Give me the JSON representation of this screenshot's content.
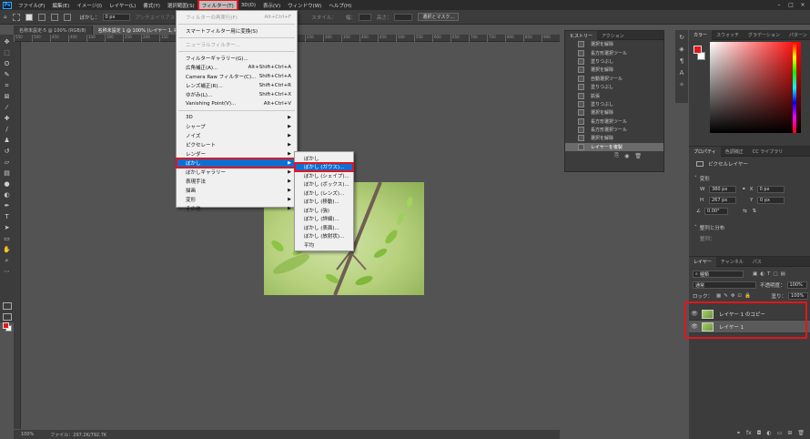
{
  "menubar": {
    "items": [
      "ファイル(F)",
      "編集(E)",
      "イメージ(I)",
      "レイヤー(L)",
      "書式(Y)",
      "選択範囲(S)",
      "フィルター(T)",
      "3D(D)",
      "表示(V)",
      "ウィンドウ(W)",
      "ヘルプ(H)"
    ],
    "active_index": 6,
    "logo": "Ps"
  },
  "options_bar": {
    "feather_label": "ぼかし：",
    "feather_value": "0 px",
    "antialias_label": "アンチエイリアス",
    "style_label": "スタイル：",
    "width_label": "幅：",
    "height_label": "高さ：",
    "select_mask_button": "選択とマスク..."
  },
  "doc_tabs": [
    "名称未設定-5 @ 100% (RGB/8)",
    "名称未設定 1 @ 100% (レイヤー 1, RGB/8)"
  ],
  "ruler_labels": [
    "550",
    "500",
    "450",
    "400",
    "350",
    "300",
    "250",
    "200",
    "150",
    "100",
    "50",
    "0",
    "50",
    "100",
    "150",
    "200",
    "250",
    "300",
    "350",
    "400",
    "450",
    "500",
    "550",
    "600",
    "650",
    "700",
    "750",
    "800",
    "850",
    "900"
  ],
  "status": {
    "zoom": "100%",
    "file_info": "ファイル：297.2K/792.7K"
  },
  "filter_menu": {
    "items": [
      {
        "label": "フィルターの再実行(F)",
        "shortcut": "Alt+Ctrl+F",
        "disabled": true
      },
      {
        "sep": true
      },
      {
        "label": "スマートフィルター用に変換(S)",
        "shortcut": ""
      },
      {
        "sep": true
      },
      {
        "label": "ニューラルフィルター...",
        "shortcut": "",
        "disabled": true
      },
      {
        "sep": true
      },
      {
        "label": "フィルターギャラリー(G)...",
        "shortcut": ""
      },
      {
        "label": "広角補正(A)...",
        "shortcut": "Alt+Shift+Ctrl+A"
      },
      {
        "label": "Camera Raw フィルター(C)...",
        "shortcut": "Shift+Ctrl+A"
      },
      {
        "label": "レンズ補正(R)...",
        "shortcut": "Shift+Ctrl+R"
      },
      {
        "label": "ゆがみ(L)...",
        "shortcut": "Shift+Ctrl+X"
      },
      {
        "label": "Vanishing Point(V)...",
        "shortcut": "Alt+Ctrl+V"
      },
      {
        "sep": true
      },
      {
        "label": "3D",
        "submenu": true
      },
      {
        "label": "シャープ",
        "submenu": true
      },
      {
        "label": "ノイズ",
        "submenu": true
      },
      {
        "label": "ピクセレート",
        "submenu": true
      },
      {
        "label": "レンダー",
        "submenu": true
      },
      {
        "label": "ぼかし",
        "submenu": true,
        "highlight": true
      },
      {
        "label": "ぼかしギャラリー",
        "submenu": true
      },
      {
        "label": "表現手法",
        "submenu": true
      },
      {
        "label": "描画",
        "submenu": true
      },
      {
        "label": "変形",
        "submenu": true
      },
      {
        "label": "その他",
        "submenu": true
      }
    ]
  },
  "blur_submenu": {
    "items": [
      "ぼかし",
      "ぼかし (ガウス)...",
      "ぼかし (シェイプ)...",
      "ぼかし (ボックス)...",
      "ぼかし (レンズ)...",
      "ぼかし (移動)...",
      "ぼかし (強)",
      "ぼかし (詳細)...",
      "ぼかし (表面)...",
      "ぼかし (放射状)...",
      "平均"
    ],
    "highlight_index": 1
  },
  "history_panel": {
    "tabs": [
      "ヒストリー",
      "アクション"
    ],
    "rows": [
      "選択を解除",
      "長方形選択ツール",
      "塗りつぶし",
      "選択を解除",
      "自動選択ツール",
      "塗りつぶし",
      "拡張",
      "塗りつぶし",
      "選択を解除",
      "長方形選択ツール",
      "長方形選択ツール",
      "選択を解除",
      "レイヤーを複製"
    ],
    "selected_index": 12
  },
  "color_panel": {
    "tabs": [
      "カラー",
      "スウォッチ",
      "グラデーション",
      "パターン"
    ],
    "foreground": "#e3161b",
    "background": "#ffffff"
  },
  "properties_panel": {
    "tabs": [
      "プロパティ",
      "色調補正",
      "CC ライブラリ"
    ],
    "type_label": "ピクセルレイヤー",
    "transform_label": "変形",
    "w_label": "W",
    "w_value": "380 px",
    "h_label": "H",
    "h_value": "267 px",
    "x_label": "X",
    "x_value": "0 px",
    "y_label": "Y",
    "y_value": "0 px",
    "angle_value": "0.00°",
    "align_label": "整列と分布",
    "align_sub": "整列："
  },
  "layers_panel": {
    "tabs": [
      "レイヤー",
      "チャンネル",
      "パス"
    ],
    "filter_label": "種類",
    "blend_mode": "通常",
    "opacity_label": "不透明度：",
    "opacity_value": "100%",
    "lock_label": "ロック：",
    "fill_label": "塗り：",
    "fill_value": "100%",
    "layers": [
      "レイヤー 1 のコピー",
      "レイヤー 1"
    ],
    "selected_index": 1
  },
  "colors": {
    "highlight_red": "#e5141b",
    "menu_highlight": "#0f6fd0",
    "app_bg": "#535353",
    "panel_bg": "#3c3c3c"
  }
}
